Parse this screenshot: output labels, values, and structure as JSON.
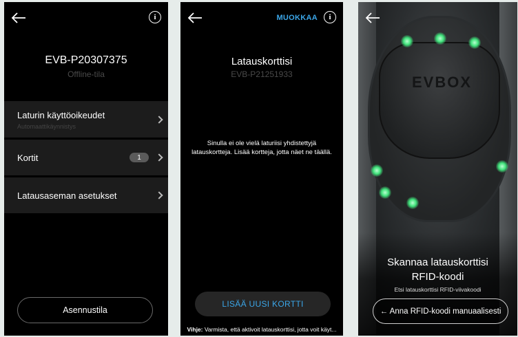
{
  "screen1": {
    "station_id": "EVB-P20307375",
    "status": "Offline-tila",
    "rows": [
      {
        "label": "Laturin käyttöoikeudet",
        "description": "Automaattikäynnistys"
      },
      {
        "label": "Kortit",
        "badge": "1"
      },
      {
        "label": "Latausaseman asetukset"
      }
    ],
    "install_button": "Asennustila"
  },
  "screen2": {
    "edit_label": "MUOKKAA",
    "title": "Latauskorttisi",
    "station_id": "EVB-P21251933",
    "empty_message": "Sinulla ei ole vielä laturiisi yhdistettyjä latauskortteja. Lisää kortteja, jotta näet ne täällä.",
    "add_button": "LISÄÄ UUSI KORTTI",
    "hint_label": "Vihje:",
    "hint_text": " Varmista, että aktivoit latauskorttisi, jotta voit käyt..."
  },
  "screen3": {
    "brand": "EVBOX",
    "title_line1": "Skannaa latauskorttisi",
    "title_line2": "RFID-koodi",
    "subtitle": "Etsi latauskorttisi RFID-viivakoodi",
    "manual_button": "← Anna RFID-koodi manuaalisesti"
  },
  "icons": {
    "back": "arrow-left-icon",
    "info": "info-icon",
    "chevron": "chevron-right-icon"
  },
  "colors": {
    "accent": "#3ba6e8",
    "background": "#000000",
    "row": "#1c1c1c",
    "muted_text": "#4a4a4a",
    "led_green": "#3fe07a"
  }
}
